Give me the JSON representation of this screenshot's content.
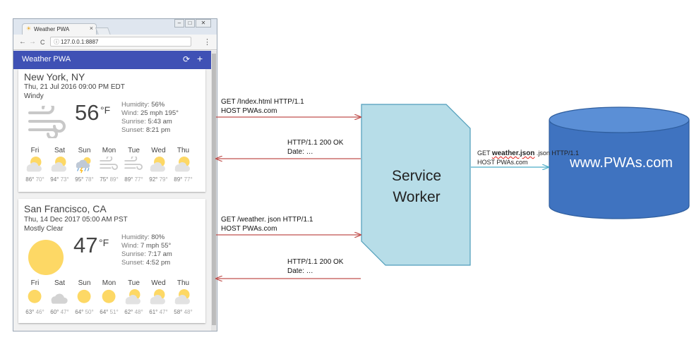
{
  "browser": {
    "tab_title": "Weather PWA",
    "tab_close": "×",
    "url": "127.0.0.1:8887",
    "window_controls": [
      "–",
      "□",
      "✕"
    ],
    "nav": {
      "back": "←",
      "forward": "→",
      "reload": "C"
    },
    "menu_icon": "⋮"
  },
  "app": {
    "title": "Weather PWA",
    "refresh_icon": "⟳",
    "add_icon": "+",
    "header_color": "#3f51b5"
  },
  "cards": [
    {
      "city": "New York, NY",
      "date": "Thu, 21 Jul 2016 09:00 PM EDT",
      "description": "Windy",
      "icon": "wind-icon",
      "temp": "56",
      "unit": "°F",
      "humidity_label": "Humidity:",
      "humidity": "56%",
      "wind_label": "Wind:",
      "wind": "25 mph 195°",
      "sunrise_label": "Sunrise:",
      "sunrise": "5:43 am",
      "sunset_label": "Sunset:",
      "sunset": "8:21 pm",
      "forecast": [
        {
          "day": "Fri",
          "icon": "partly-cloudy-icon",
          "hi": "86°",
          "lo": "70°"
        },
        {
          "day": "Sat",
          "icon": "partly-cloudy-icon",
          "hi": "94°",
          "lo": "73°"
        },
        {
          "day": "Sun",
          "icon": "thunderstorm-icon",
          "hi": "95°",
          "lo": "78°"
        },
        {
          "day": "Mon",
          "icon": "wind-icon",
          "hi": "75°",
          "lo": "89°"
        },
        {
          "day": "Tue",
          "icon": "wind-icon",
          "hi": "89°",
          "lo": "77°"
        },
        {
          "day": "Wed",
          "icon": "partly-cloudy-icon",
          "hi": "92°",
          "lo": "79°"
        },
        {
          "day": "Thu",
          "icon": "partly-cloudy-icon",
          "hi": "89°",
          "lo": "77°"
        }
      ]
    },
    {
      "city": "San Francisco, CA",
      "date": "Thu, 14 Dec 2017 05:00 AM PST",
      "description": "Mostly Clear",
      "icon": "sun-icon",
      "temp": "47",
      "unit": "°F",
      "humidity_label": "Humidity:",
      "humidity": "80%",
      "wind_label": "Wind:",
      "wind": "7 mph 55°",
      "sunrise_label": "Sunrise:",
      "sunrise": "7:17 am",
      "sunset_label": "Sunset:",
      "sunset": "4:52 pm",
      "forecast": [
        {
          "day": "Fri",
          "icon": "sun-icon",
          "hi": "63°",
          "lo": "46°"
        },
        {
          "day": "Sat",
          "icon": "cloud-icon",
          "hi": "60°",
          "lo": "47°"
        },
        {
          "day": "Sun",
          "icon": "sun-icon",
          "hi": "64°",
          "lo": "50°"
        },
        {
          "day": "Mon",
          "icon": "sun-icon",
          "hi": "64°",
          "lo": "51°"
        },
        {
          "day": "Tue",
          "icon": "partly-cloudy-icon",
          "hi": "62°",
          "lo": "48°"
        },
        {
          "day": "Wed",
          "icon": "partly-cloudy-icon",
          "hi": "61°",
          "lo": "47°"
        },
        {
          "day": "Thu",
          "icon": "partly-cloudy-icon",
          "hi": "58°",
          "lo": "48°"
        }
      ]
    }
  ],
  "diagram": {
    "service_worker": {
      "line1": "Service",
      "line2": "Worker",
      "fill": "#b7dde8"
    },
    "server": {
      "label": "www.PWAs.com",
      "fill": "#3f73c0"
    },
    "arrow_color": "#c0504d",
    "arrow_color_server": "#4bacc6",
    "request1": {
      "line1": "GET /Index.html HTTP/1.1",
      "line2": "HOST PWAs.com"
    },
    "response1": {
      "line1": "HTTP/1.1 200 OK",
      "line2": "Date: …"
    },
    "request2": {
      "line1": "GET /weather. json HTTP/1.1",
      "line2": "HOST PWAs.com"
    },
    "response2": {
      "line1": "HTTP/1.1 200 OK",
      "line2": "Date: …"
    },
    "request3": {
      "prefix": "GET ",
      "highlight": "weather.json",
      "rest": " .json HTTP/1.1",
      "line2": "HOST PWAs.com"
    }
  }
}
